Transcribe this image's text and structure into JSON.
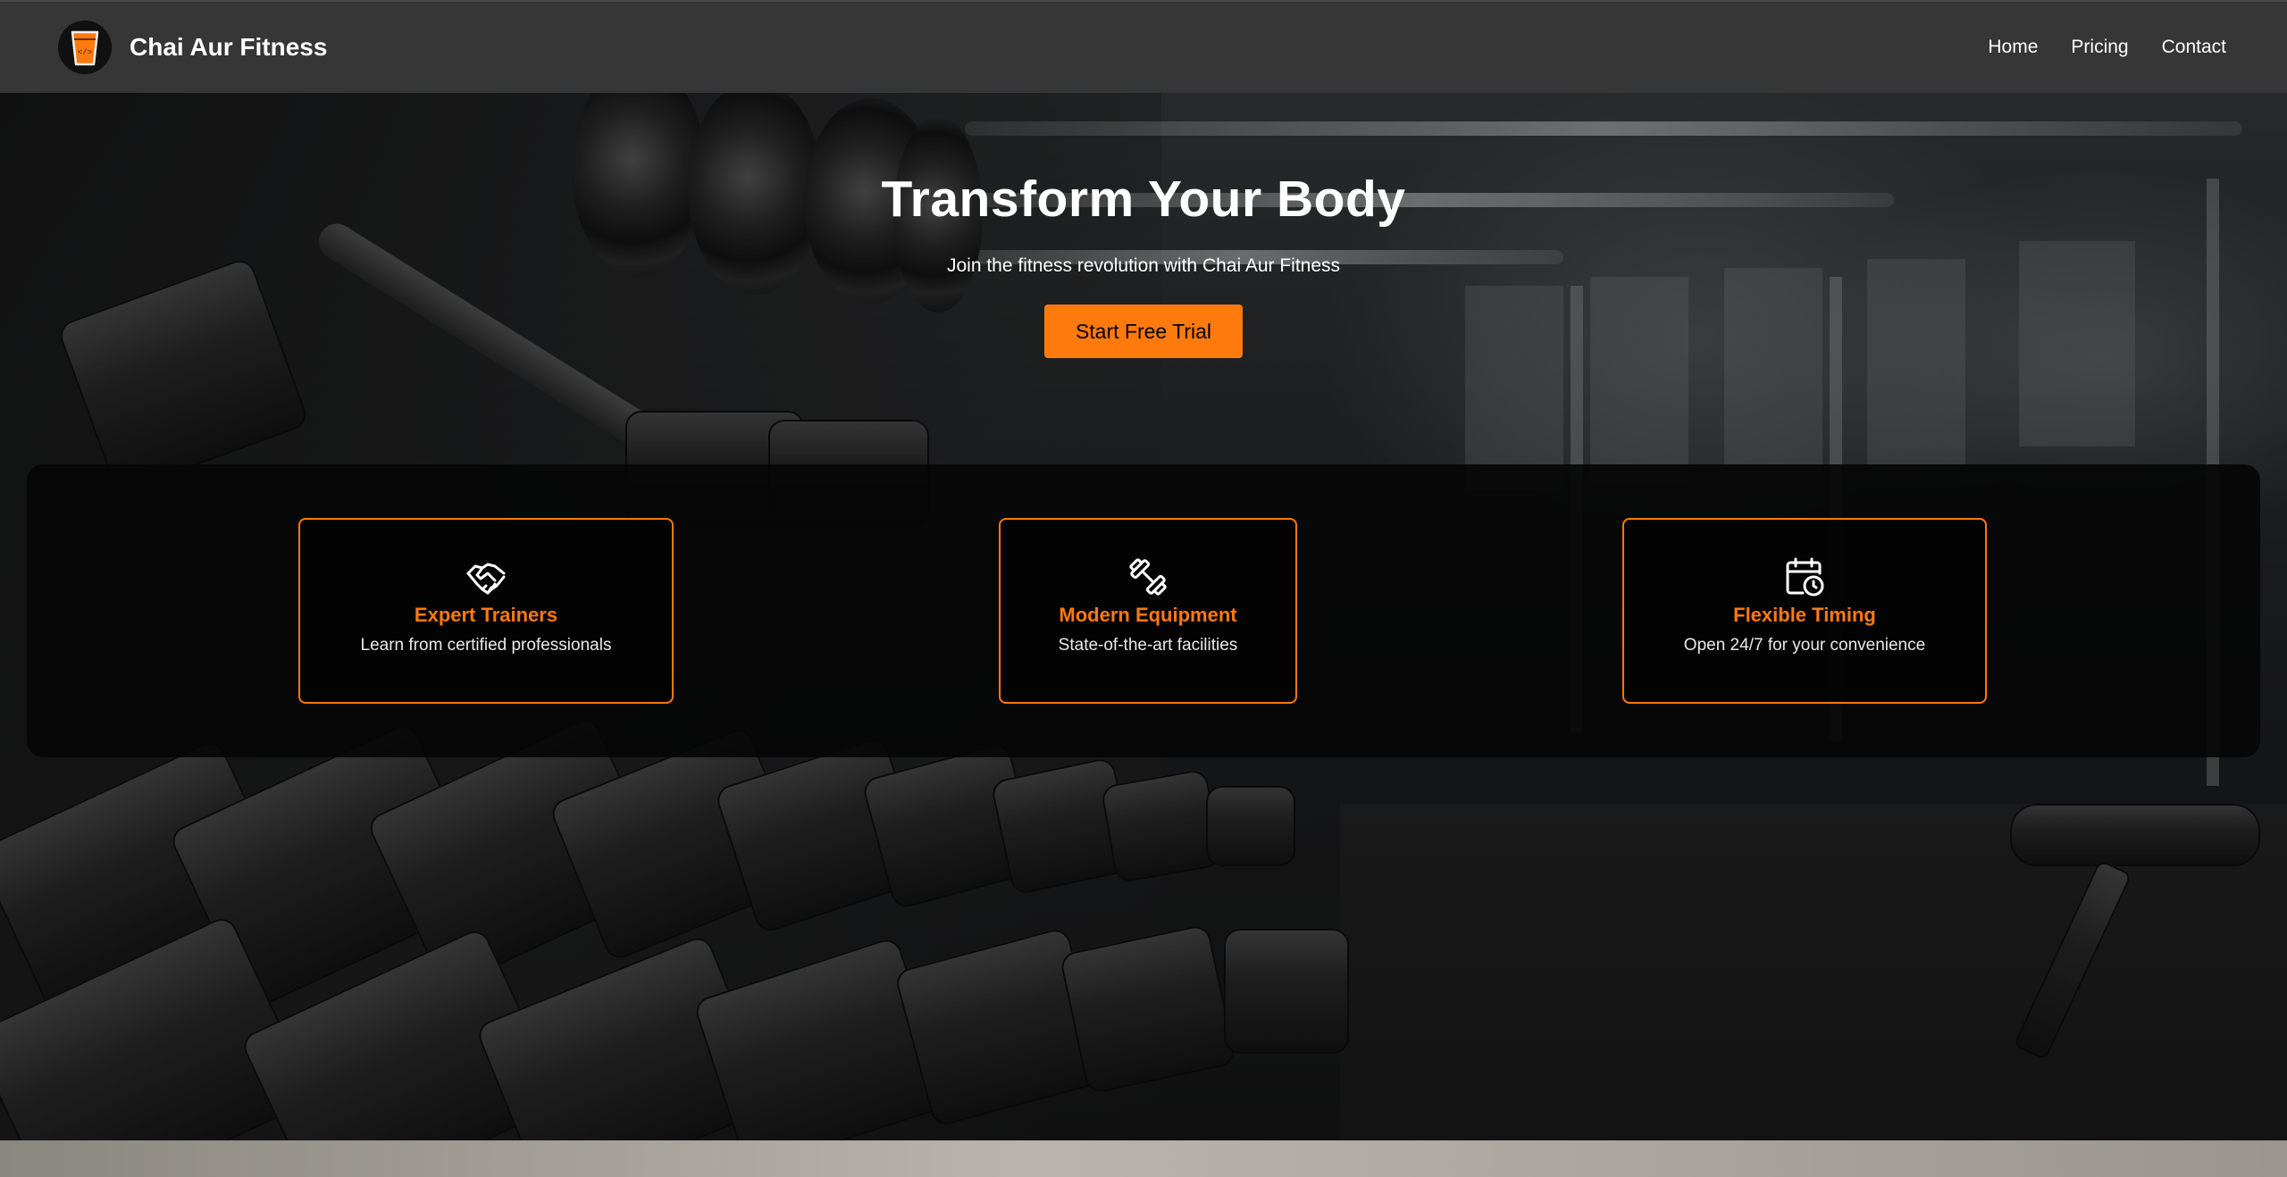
{
  "navbar": {
    "brand_name": "Chai Aur Fitness",
    "links": [
      {
        "label": "Home"
      },
      {
        "label": "Pricing"
      },
      {
        "label": "Contact"
      }
    ]
  },
  "hero": {
    "title": "Transform Your Body",
    "subtitle": "Join the fitness revolution with Chai Aur Fitness",
    "cta_label": "Start Free Trial"
  },
  "features": [
    {
      "icon": "handshake-icon",
      "title": "Expert Trainers",
      "description": "Learn from certified professionals"
    },
    {
      "icon": "dumbbell-icon",
      "title": "Modern Equipment",
      "description": "State-of-the-art facilities"
    },
    {
      "icon": "calendar-clock-icon",
      "title": "Flexible Timing",
      "description": "Open 24/7 for your convenience"
    }
  ],
  "colors": {
    "accent": "#ff7a0d",
    "navbar_bg": "#363636",
    "text": "#ffffff"
  }
}
